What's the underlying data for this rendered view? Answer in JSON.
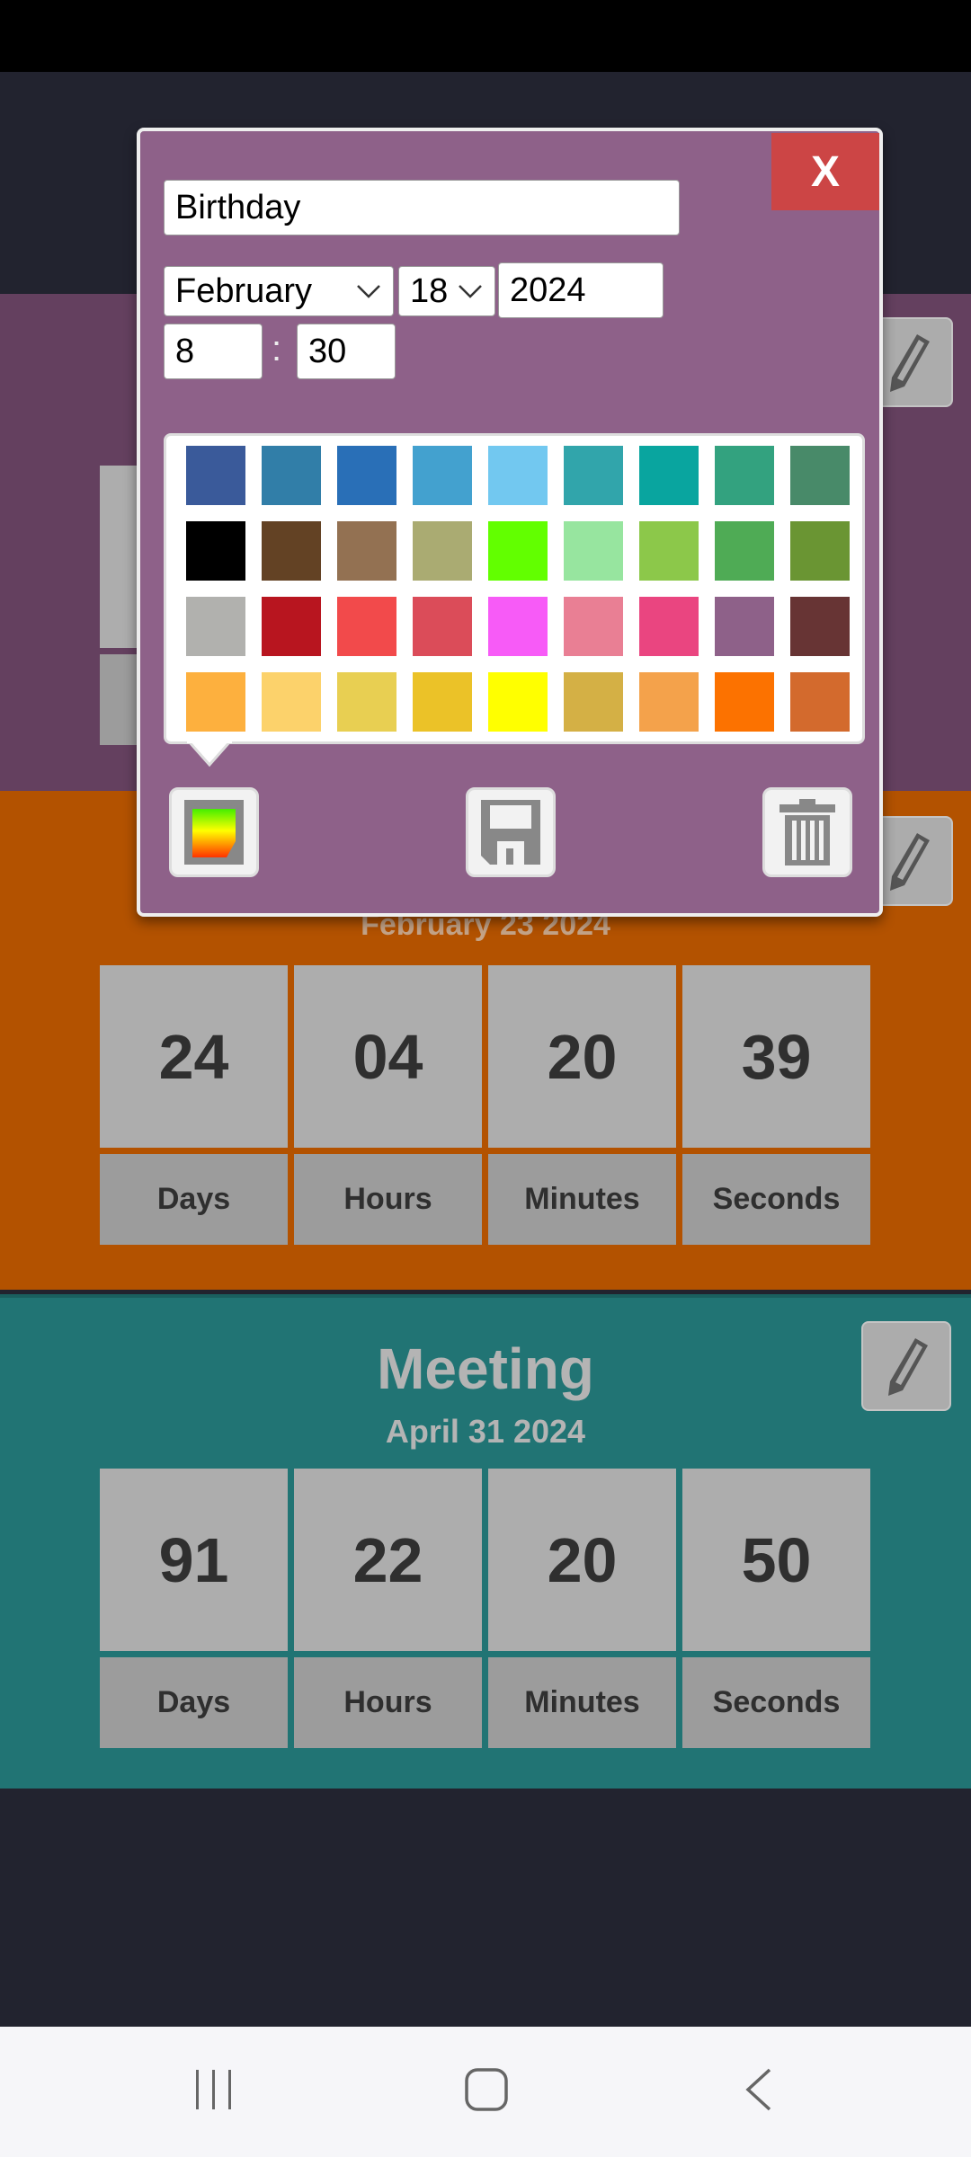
{
  "cards": [
    {
      "color": "#64405f"
    },
    {
      "color": "#b35200",
      "date": "February 23 2024",
      "values": [
        "24",
        "04",
        "20",
        "39"
      ],
      "labels": [
        "Days",
        "Hours",
        "Minutes",
        "Seconds"
      ]
    },
    {
      "color": "#217474",
      "title": "Meeting",
      "date": "April 31 2024",
      "values": [
        "91",
        "22",
        "20",
        "50"
      ],
      "labels": [
        "Days",
        "Hours",
        "Minutes",
        "Seconds"
      ]
    }
  ],
  "editor": {
    "close_label": "X",
    "name_value": "Birthday",
    "month_value": "February",
    "day_value": "18",
    "year_value": "2024",
    "hour_value": "8",
    "time_separator": ":",
    "minute_value": "30",
    "background_color": "#8e6189",
    "palette": [
      [
        "#3a5a9a",
        "#317ea8",
        "#296fb7",
        "#43a1cf",
        "#72c8f0",
        "#31a5ab",
        "#09a59f",
        "#33a27f",
        "#488a69"
      ],
      [
        "#000000",
        "#634224",
        "#937152",
        "#aaab72",
        "#62ff00",
        "#97e59f",
        "#8cc84a",
        "#4fab55",
        "#6a9533"
      ],
      [
        "#b1b1ae",
        "#b8151f",
        "#f24a4b",
        "#db4c59",
        "#f75bf7",
        "#e97f94",
        "#ea4580",
        "#8e6189",
        "#673434"
      ],
      [
        "#fdb03e",
        "#fcd26b",
        "#e8cf52",
        "#ebc228",
        "#ffff00",
        "#d4b045",
        "#f4a24b",
        "#fc7200",
        "#d36a2d"
      ]
    ]
  },
  "nav": {
    "recents": "recents-icon",
    "home": "home-icon",
    "back": "back-icon"
  }
}
